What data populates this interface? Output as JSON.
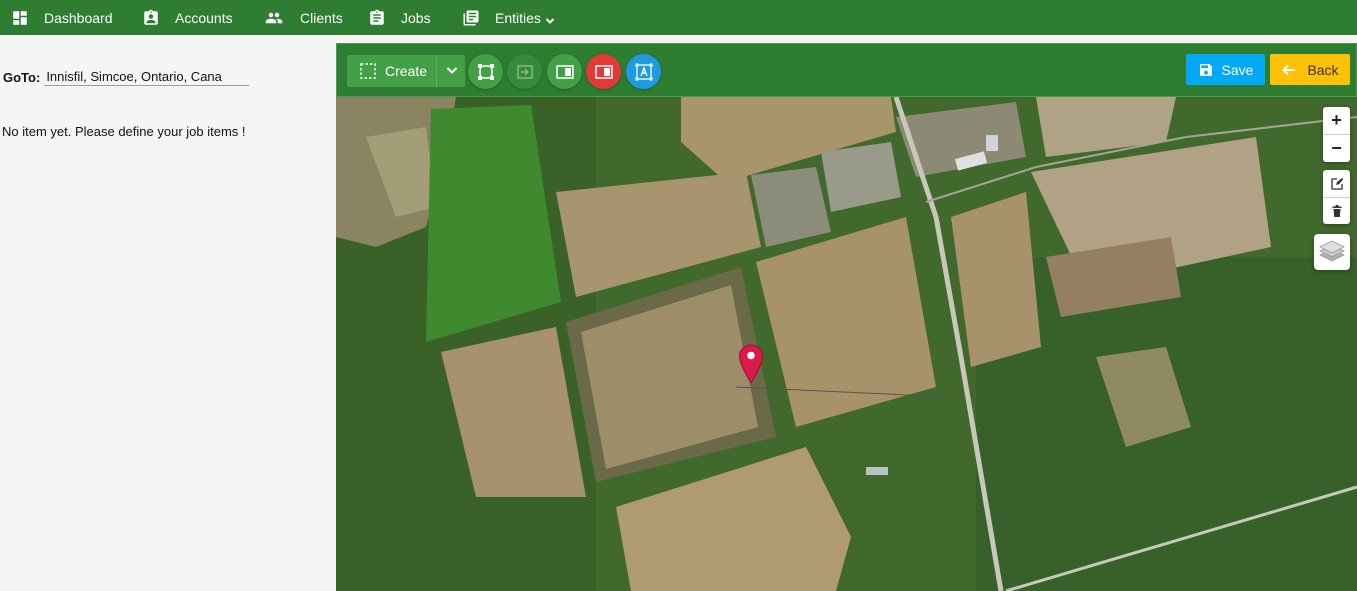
{
  "nav": {
    "dashboard": "Dashboard",
    "accounts": "Accounts",
    "clients": "Clients",
    "jobs": "Jobs",
    "entities": "Entities"
  },
  "left": {
    "goto_label": "GoTo:",
    "goto_value": "Innisfil, Simcoe, Ontario, Cana",
    "empty_message": "No item yet. Please define your job items !"
  },
  "toolbar": {
    "create_label": "Create",
    "save_label": "Save",
    "back_label": "Back"
  },
  "map": {
    "zoom_in": "+",
    "zoom_out": "−"
  },
  "colors": {
    "nav_green": "#2e7d32",
    "button_green": "#43a047",
    "save_blue": "#03a9f4",
    "back_yellow": "#ffc107",
    "delete_red": "#e53935",
    "text_blue": "#1e9be0",
    "marker_red": "#d81b4a"
  },
  "icons": [
    "dashboard-icon",
    "accounts-icon",
    "clients-icon",
    "jobs-icon",
    "entities-icon",
    "chevron-down-icon",
    "select-area-icon",
    "save-icon",
    "back-arrow-icon",
    "edit-icon",
    "trash-icon",
    "layers-icon",
    "map-marker-icon"
  ]
}
